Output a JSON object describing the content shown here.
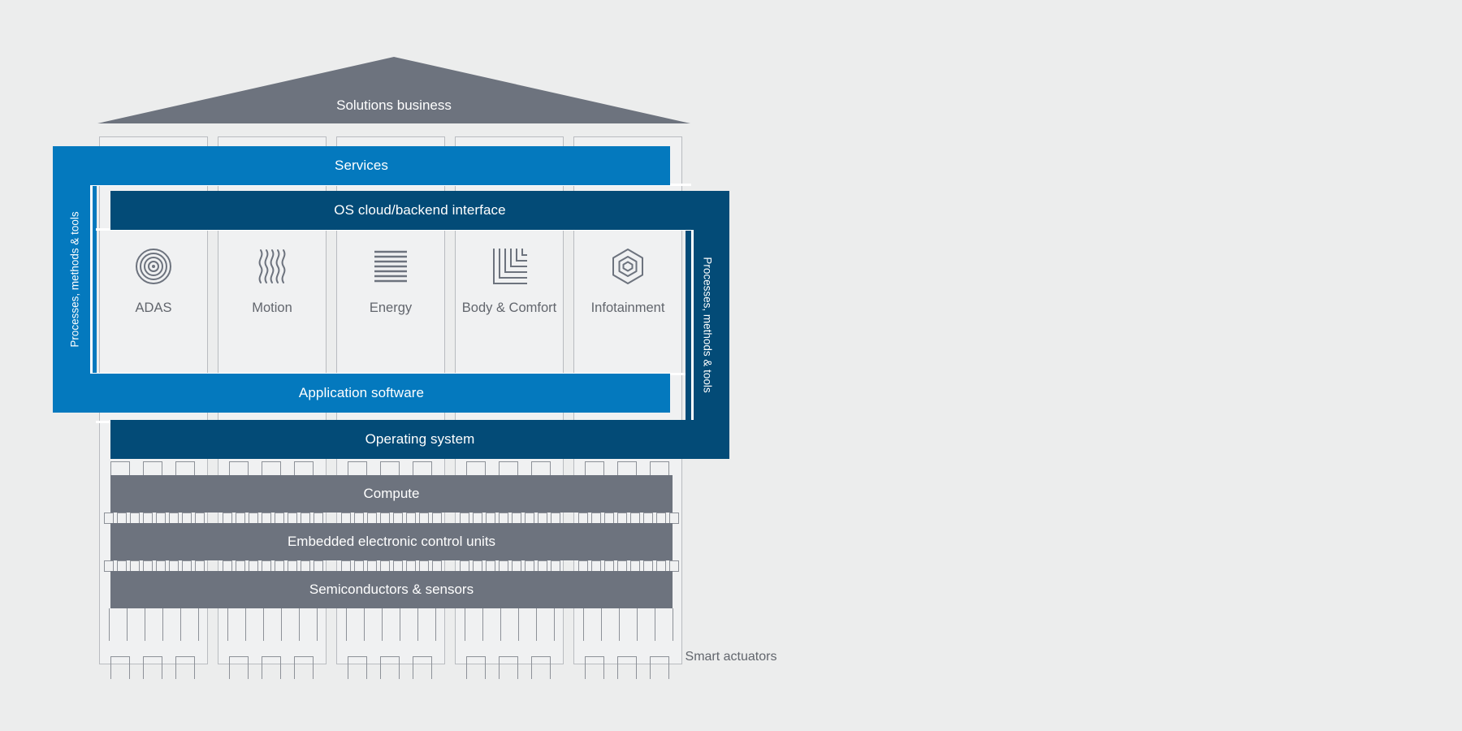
{
  "diagram": {
    "title": "Solutions business",
    "background_color": "#eceded",
    "colors": {
      "light_blue": "#0479be",
      "dark_blue": "#034b77",
      "gray": "#6d737e",
      "outline": "#b9bcc0",
      "text_gray": "#62666d"
    },
    "roof": {
      "label": "Solutions business"
    },
    "bars": {
      "services": "Services",
      "os_cloud_backend_interface": "OS cloud/backend interface",
      "application_software": "Application software",
      "operating_system": "Operating system",
      "compute": "Compute",
      "embedded_electronic_control_units": "Embedded electronic control units",
      "semiconductors_sensors": "Semiconductors & sensors",
      "smart_actuators": "Smart actuators"
    },
    "side_frames": {
      "left_label": "Processes, methods & tools",
      "right_label": "Processes, methods & tools"
    },
    "domains": [
      {
        "label": "ADAS",
        "icon": "concentric-circles-icon"
      },
      {
        "label": "Motion",
        "icon": "wavy-lines-icon"
      },
      {
        "label": "Energy",
        "icon": "horizontal-lines-icon"
      },
      {
        "label": "Body &\nComfort",
        "icon": "nested-corners-icon"
      },
      {
        "label": "Infotainment",
        "icon": "nested-hexagon-icon"
      }
    ]
  }
}
